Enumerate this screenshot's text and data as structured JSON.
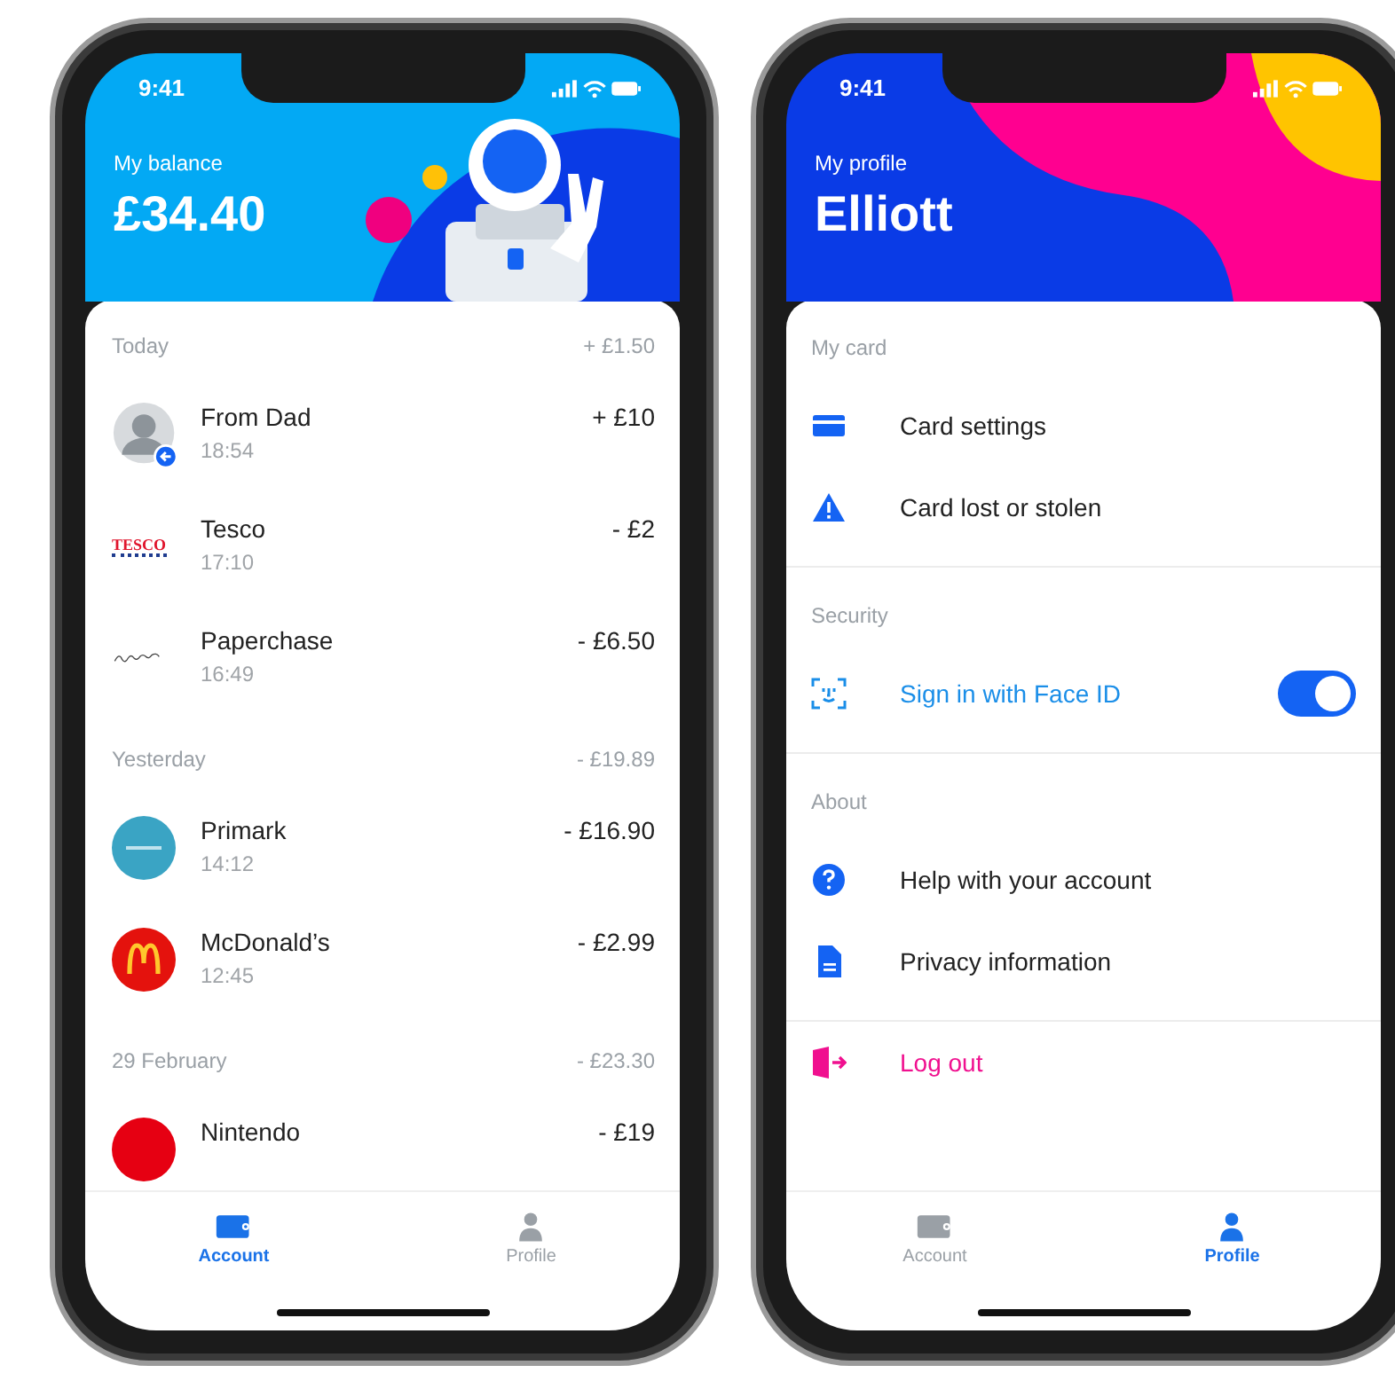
{
  "account_screen": {
    "status_time": "9:41",
    "header": {
      "label": "My balance",
      "title": "£34.40"
    },
    "sections": [
      {
        "title": "Today",
        "total": "+ £1.50",
        "rows": [
          {
            "kind": "avatar",
            "name": "From Dad",
            "time": "18:54",
            "amount": "+ £10"
          },
          {
            "kind": "tesco",
            "logo_text": "TESCO",
            "name": "Tesco",
            "time": "17:10",
            "amount": "- £2"
          },
          {
            "kind": "paperchase",
            "name": "Paperchase",
            "time": "16:49",
            "amount": "- £6.50"
          }
        ]
      },
      {
        "title": "Yesterday",
        "total": "- £19.89",
        "rows": [
          {
            "kind": "primark",
            "name": "Primark",
            "time": "14:12",
            "amount": "- £16.90"
          },
          {
            "kind": "mcdonalds",
            "name": "McDonald’s",
            "time": "12:45",
            "amount": "- £2.99"
          }
        ]
      },
      {
        "title": "29 February",
        "total": "- £23.30",
        "rows": [
          {
            "kind": "nintendo",
            "name": "Nintendo",
            "amount": "- £19"
          }
        ]
      }
    ],
    "tabs": [
      {
        "label": "Account",
        "selected": true
      },
      {
        "label": "Profile",
        "selected": false
      }
    ]
  },
  "profile_screen": {
    "status_time": "9:41",
    "header": {
      "label": "My profile",
      "title": "Elliott"
    },
    "sections": [
      {
        "title": "My card",
        "rows": [
          {
            "kind": "card",
            "label": "Card settings"
          },
          {
            "kind": "warning",
            "label": "Card lost or stolen"
          }
        ]
      },
      {
        "title": "Security",
        "rows": [
          {
            "kind": "faceid",
            "label": "Sign in with Face ID",
            "on": true
          }
        ]
      },
      {
        "title": "About",
        "rows": [
          {
            "kind": "help",
            "label": "Help with your account"
          },
          {
            "kind": "document",
            "label": "Privacy information"
          }
        ]
      },
      {
        "rows": [
          {
            "kind": "logout",
            "label": "Log out"
          }
        ]
      }
    ],
    "tabs": [
      {
        "label": "Account",
        "selected": false
      },
      {
        "label": "Profile",
        "selected": true
      }
    ]
  }
}
